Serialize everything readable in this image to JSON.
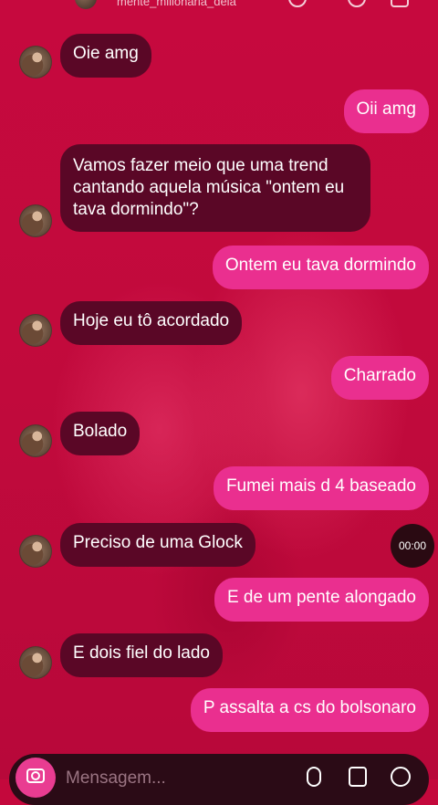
{
  "header": {
    "username": "mente_milionaria_dela"
  },
  "messages": [
    {
      "side": "in",
      "text": "Oie amg"
    },
    {
      "side": "out",
      "text": "Oii amg"
    },
    {
      "side": "in",
      "text": "Vamos fazer meio que uma trend cantando aquela música \"ontem eu tava dormindo\"?"
    },
    {
      "side": "out",
      "text": "Ontem eu tava dormindo"
    },
    {
      "side": "in",
      "text": "Hoje eu tô acordado"
    },
    {
      "side": "out",
      "text": "Charrado"
    },
    {
      "side": "in",
      "text": "Bolado"
    },
    {
      "side": "out",
      "text": "Fumei mais d 4 baseado"
    },
    {
      "side": "in",
      "text": "Preciso de uma Glock"
    },
    {
      "side": "out",
      "text": "E de um pente alongado"
    },
    {
      "side": "in",
      "text": "E dois fiel do lado"
    },
    {
      "side": "out",
      "text": "P assalta a cs do bolsonaro"
    }
  ],
  "timer": "00:00",
  "composer": {
    "placeholder": "Mensagem..."
  },
  "icons": [
    "camera-icon",
    "mic-icon",
    "gallery-icon",
    "sticker-icon"
  ]
}
